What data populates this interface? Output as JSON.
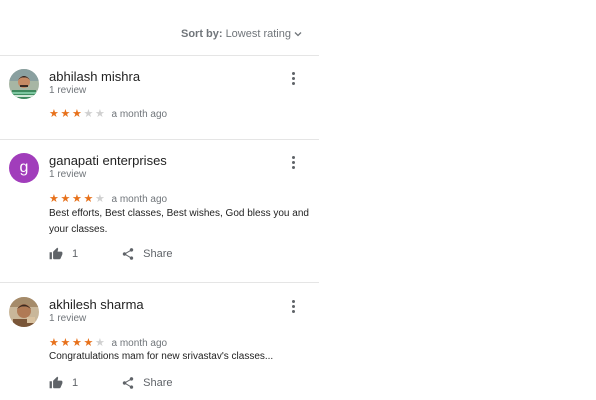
{
  "sort": {
    "label": "Sort by:",
    "value": "Lowest rating"
  },
  "reviews": [
    {
      "name": "abhilash mishra",
      "count": "1 review",
      "rating": 3,
      "time": "a month ago",
      "text": "",
      "likes": "",
      "share": ""
    },
    {
      "name": "ganapati enterprises",
      "initial": "g",
      "count": "1 review",
      "rating": 4,
      "time": "a month ago",
      "text": "Best efforts, Best classes, Best wishes, God bless you and your classes.",
      "likes": "1",
      "share": "Share"
    },
    {
      "name": "akhilesh sharma",
      "count": "1 review",
      "rating": 4,
      "time": "a month ago",
      "text": "Congratulations mam for new srivastav's classes...",
      "likes": "1",
      "share": "Share"
    }
  ],
  "colors": {
    "star_on": "#e7711b",
    "star_off": "#d0d0d0",
    "avatar_letter_bg": "#a13dbb",
    "muted": "#70757a"
  },
  "icons": {
    "sort": "chevron-down-icon",
    "menu": "more-vert-icon",
    "like": "thumb-up-icon",
    "share": "share-icon"
  }
}
